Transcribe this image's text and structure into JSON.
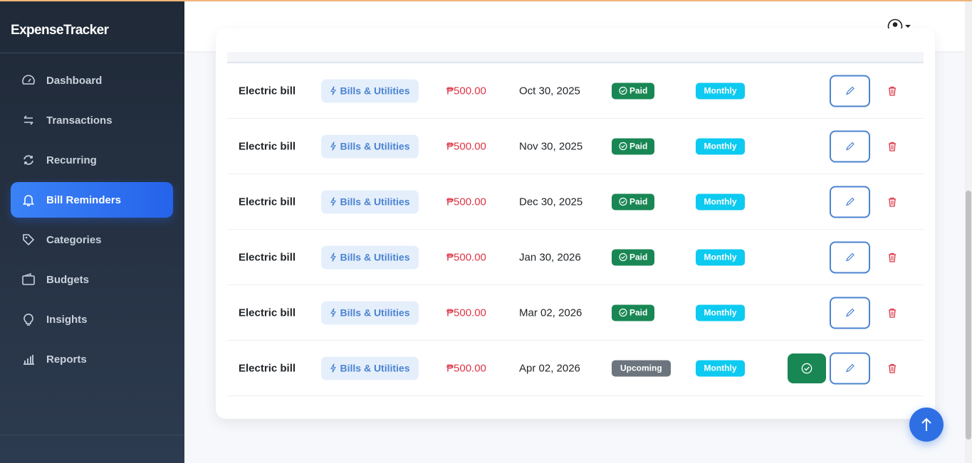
{
  "app": {
    "title": "ExpenseTracker"
  },
  "sidebar": {
    "items": [
      {
        "label": "Dashboard",
        "icon": "speedometer-icon"
      },
      {
        "label": "Transactions",
        "icon": "arrows-exchange-icon"
      },
      {
        "label": "Recurring",
        "icon": "repeat-icon"
      },
      {
        "label": "Bill Reminders",
        "icon": "bell-icon",
        "active": true
      },
      {
        "label": "Categories",
        "icon": "tags-icon"
      },
      {
        "label": "Budgets",
        "icon": "wallet-icon"
      },
      {
        "label": "Insights",
        "icon": "lightbulb-icon"
      },
      {
        "label": "Reports",
        "icon": "bar-chart-icon"
      }
    ]
  },
  "bills": [
    {
      "name": "Electric bill",
      "category": "Bills & Utilities",
      "amount": "₱500.00",
      "date": "Oct 30, 2025",
      "status": "Paid",
      "frequency": "Monthly"
    },
    {
      "name": "Electric bill",
      "category": "Bills & Utilities",
      "amount": "₱500.00",
      "date": "Nov 30, 2025",
      "status": "Paid",
      "frequency": "Monthly"
    },
    {
      "name": "Electric bill",
      "category": "Bills & Utilities",
      "amount": "₱500.00",
      "date": "Dec 30, 2025",
      "status": "Paid",
      "frequency": "Monthly"
    },
    {
      "name": "Electric bill",
      "category": "Bills & Utilities",
      "amount": "₱500.00",
      "date": "Jan 30, 2026",
      "status": "Paid",
      "frequency": "Monthly"
    },
    {
      "name": "Electric bill",
      "category": "Bills & Utilities",
      "amount": "₱500.00",
      "date": "Mar 02, 2026",
      "status": "Paid",
      "frequency": "Monthly"
    },
    {
      "name": "Electric bill",
      "category": "Bills & Utilities",
      "amount": "₱500.00",
      "date": "Apr 02, 2026",
      "status": "Upcoming",
      "frequency": "Monthly"
    }
  ],
  "colors": {
    "accent": "#2563eb",
    "paid": "#198754",
    "upcoming": "#6c757d",
    "monthly": "#0dcaf0",
    "amount": "#dc3545"
  }
}
